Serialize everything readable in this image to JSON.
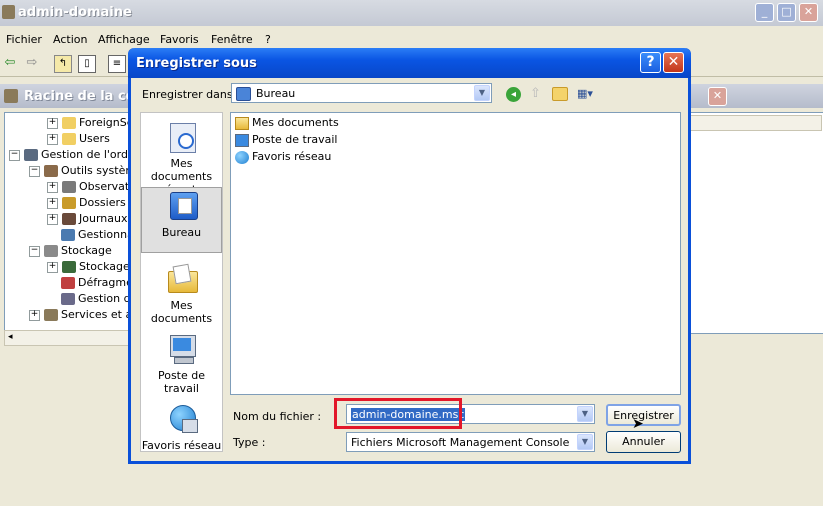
{
  "main_window": {
    "title": "admin-domaine",
    "menu": [
      "Fichier",
      "Action",
      "Affichage",
      "Favoris",
      "Fenêtre",
      "?"
    ]
  },
  "console_window": {
    "title": "Racine de la cons",
    "tree": [
      {
        "label": "ForeignSe",
        "icon": "folder-icon"
      },
      {
        "label": "Users",
        "icon": "folder-icon"
      },
      {
        "label": "Gestion de l'ordina",
        "icon": "computer-icon"
      },
      {
        "label": "Outils système",
        "icon": "tools-icon"
      },
      {
        "label": "Observate",
        "icon": "event-viewer-icon"
      },
      {
        "label": "Dossiers p",
        "icon": "shared-folders-icon"
      },
      {
        "label": "Journaux",
        "icon": "logs-icon"
      },
      {
        "label": "Gestionna",
        "icon": "device-manager-icon"
      },
      {
        "label": "Stockage",
        "icon": "storage-icon"
      },
      {
        "label": "Stockage",
        "icon": "removable-storage-icon"
      },
      {
        "label": "Défragme",
        "icon": "defrag-icon"
      },
      {
        "label": "Gestion de",
        "icon": "disk-management-icon"
      },
      {
        "label": "Services et ap",
        "icon": "services-icon"
      }
    ]
  },
  "dialog": {
    "title": "Enregistrer sous",
    "save_in_label": "Enregistrer dans :",
    "save_in_value": "Bureau",
    "places": [
      {
        "label": "Mes documents récents",
        "icon": "recent-documents-icon"
      },
      {
        "label": "Bureau",
        "icon": "desktop-icon"
      },
      {
        "label": "Mes documents",
        "icon": "my-documents-icon"
      },
      {
        "label": "Poste de travail",
        "icon": "my-computer-icon"
      },
      {
        "label": "Favoris réseau",
        "icon": "network-places-icon"
      }
    ],
    "files": [
      {
        "label": "Mes documents",
        "icon": "folder-icon"
      },
      {
        "label": "Poste de travail",
        "icon": "computer-icon"
      },
      {
        "label": "Favoris réseau",
        "icon": "network-icon"
      }
    ],
    "filename_label": "Nom du fichier :",
    "filename_value": "admin-domaine.msc",
    "type_label": "Type :",
    "type_value": "Fichiers Microsoft Management Console (*.msc)",
    "save_button": "Enregistrer",
    "cancel_button": "Annuler"
  },
  "colors": {
    "dialog_title": "#0a55e3",
    "highlight": "#e2172a",
    "selection": "#316ac5"
  }
}
